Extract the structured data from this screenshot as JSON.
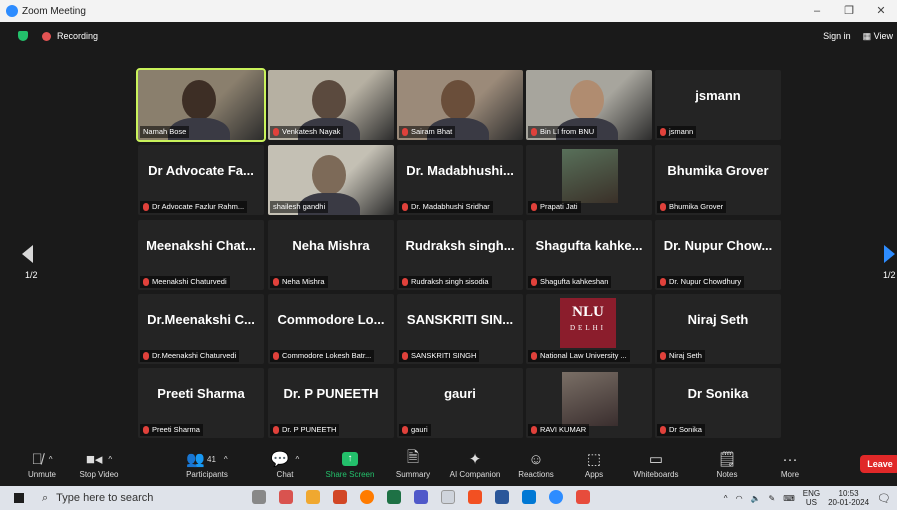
{
  "window": {
    "title": "Zoom Meeting",
    "controls": [
      "–",
      "❐",
      "✕"
    ]
  },
  "meeting": {
    "recording_label": "Recording",
    "sign_in": "Sign in",
    "view": "View"
  },
  "pagination": {
    "left": "1/2",
    "right": "1/2"
  },
  "tiles": [
    {
      "big": "",
      "label": "Namah Bose",
      "muted": false,
      "video": true,
      "active": true
    },
    {
      "big": "",
      "label": "Venkatesh Nayak",
      "muted": true,
      "video": true
    },
    {
      "big": "",
      "label": "Sairam Bhat",
      "muted": true,
      "video": true
    },
    {
      "big": "",
      "label": "Bin LI from BNU",
      "muted": true,
      "video": true
    },
    {
      "big": "jsmann",
      "label": "jsmann",
      "muted": true
    },
    {
      "big": "Dr Advocate Fa...",
      "label": "Dr Advocate Fazlur Rahm...",
      "muted": true
    },
    {
      "big": "",
      "label": "shailesh gandhi",
      "muted": false,
      "video": true
    },
    {
      "big": "Dr. Madabhushi...",
      "label": "Dr. Madabhushi Sridhar",
      "muted": true
    },
    {
      "big": "",
      "label": "Prapati Jati",
      "muted": true,
      "video": true
    },
    {
      "big": "Bhumika Grover",
      "label": "Bhumika Grover",
      "muted": true
    },
    {
      "big": "Meenakshi Chat...",
      "label": "Meenakshi Chaturvedi",
      "muted": true
    },
    {
      "big": "Neha Mishra",
      "label": "Neha Mishra",
      "muted": true
    },
    {
      "big": "Rudraksh singh...",
      "label": "Rudraksh singh sisodia",
      "muted": true
    },
    {
      "big": "Shagufta kahke...",
      "label": "Shagufta kahkeshan",
      "muted": true
    },
    {
      "big": "Dr. Nupur Chow...",
      "label": "Dr. Nupur Chowdhury",
      "muted": true
    },
    {
      "big": "Dr.Meenakshi C...",
      "label": "Dr.Meenakshi Chaturvedi",
      "muted": true
    },
    {
      "big": "Commodore Lo...",
      "label": "Commodore Lokesh Batr...",
      "muted": true
    },
    {
      "big": "SANSKRITI SIN...",
      "label": "SANSKRITI SINGH",
      "muted": true
    },
    {
      "big": "",
      "label": "National Law University ...",
      "muted": true,
      "logo": "NLU DELHI"
    },
    {
      "big": "Niraj Seth",
      "label": "Niraj Seth",
      "muted": true
    },
    {
      "big": "Preeti Sharma",
      "label": "Preeti Sharma",
      "muted": true
    },
    {
      "big": "Dr. P PUNEETH",
      "label": "Dr. P PUNEETH",
      "muted": true
    },
    {
      "big": "gauri",
      "label": "gauri",
      "muted": true
    },
    {
      "big": "",
      "label": "RAVI KUMAR",
      "muted": true,
      "video": true
    },
    {
      "big": "Dr Sonika",
      "label": "Dr Sonika",
      "muted": true
    }
  ],
  "toolbar": {
    "unmute": "Unmute",
    "stop_video": "Stop Video",
    "participants": "Participants",
    "participants_count": "41",
    "chat": "Chat",
    "share_screen": "Share Screen",
    "summary": "Summary",
    "ai_companion": "AI Companion",
    "reactions": "Reactions",
    "apps": "Apps",
    "whiteboards": "Whiteboards",
    "notes": "Notes",
    "more": "More",
    "leave": "Leave"
  },
  "taskbar": {
    "search_placeholder": "Type here to search",
    "lang_top": "ENG",
    "lang_bottom": "US",
    "time": "10:53",
    "date": "20-01-2024"
  },
  "colors": {
    "accent": "#2d8cff",
    "share": "#23c06b",
    "leave": "#e02828",
    "muted_mic": "#e0413b",
    "active_speaker": "#c9f25b"
  }
}
